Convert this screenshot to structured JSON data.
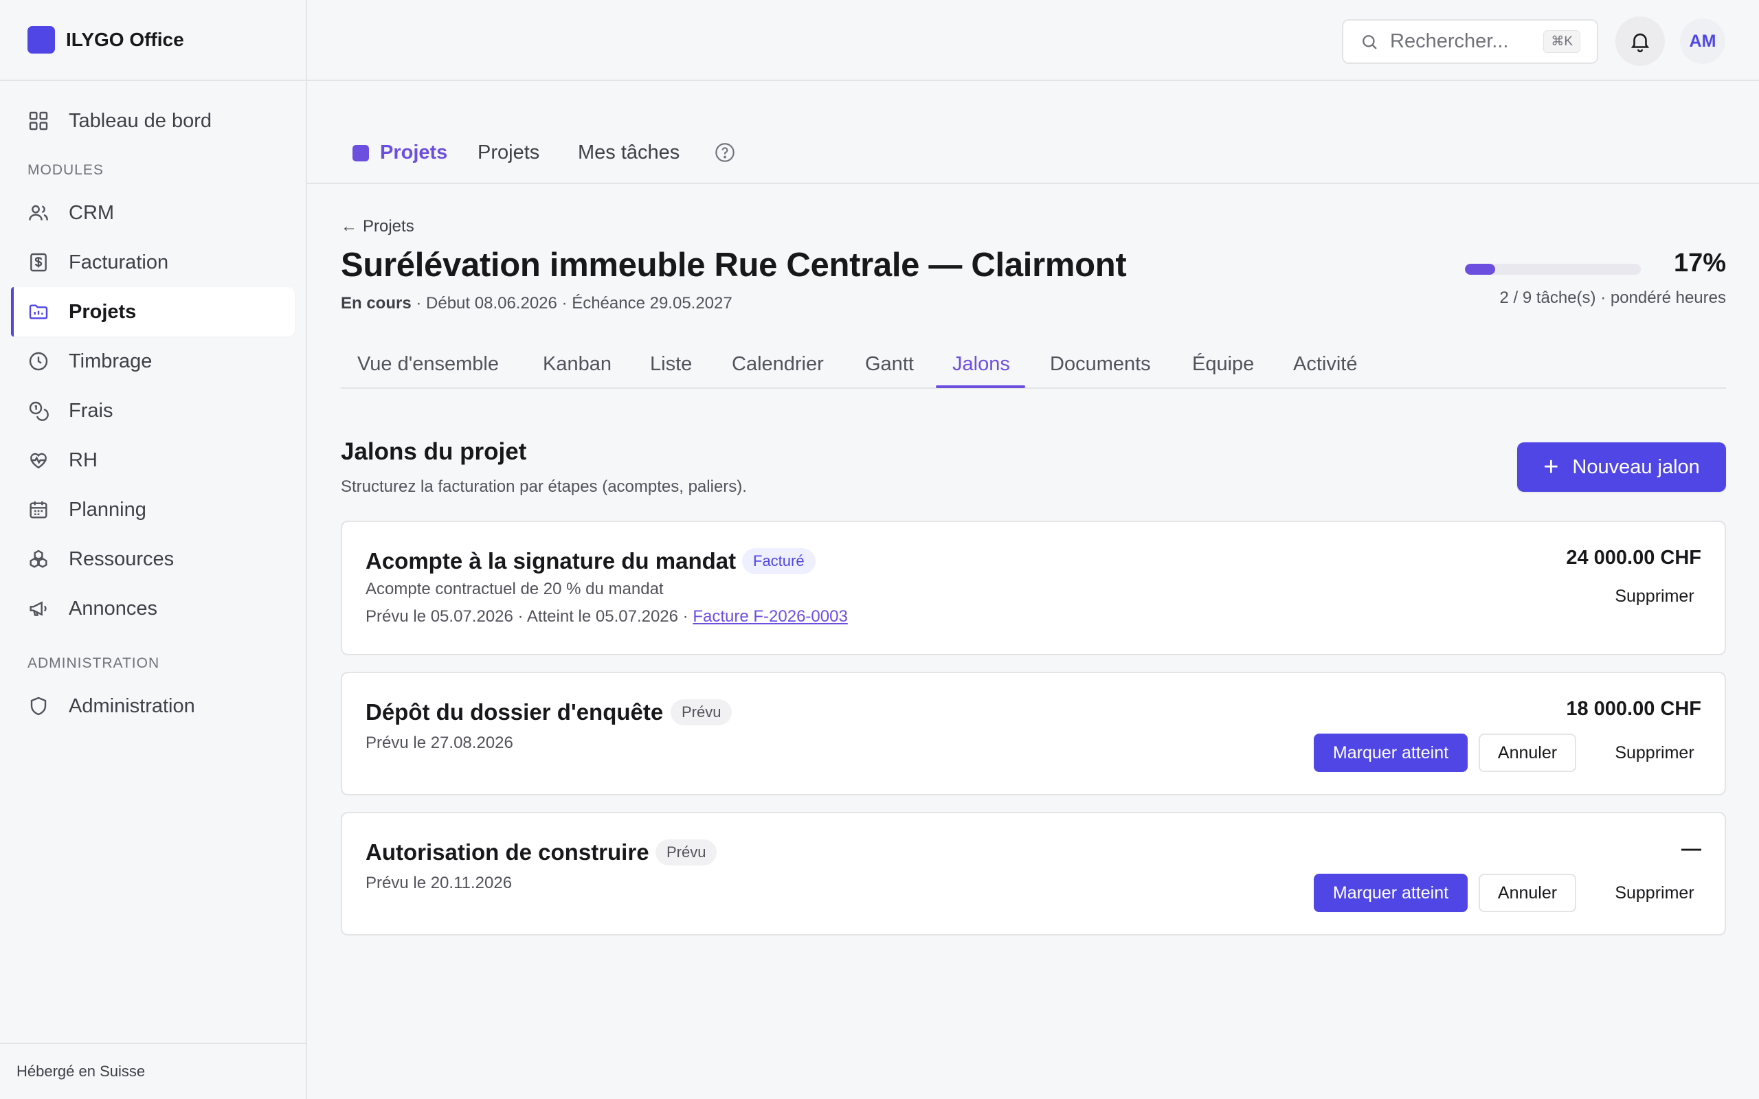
{
  "app": {
    "name": "ILYGO Office",
    "brand_color": "#4f46e5"
  },
  "sidebar": {
    "dashboard": {
      "label": "Tableau de bord",
      "icon": "grid-icon"
    },
    "modules_label": "MODULES",
    "items": [
      {
        "label": "CRM",
        "icon": "users-icon"
      },
      {
        "label": "Facturation",
        "icon": "invoice-icon"
      },
      {
        "label": "Projets",
        "icon": "folder-icon",
        "active": true
      },
      {
        "label": "Timbrage",
        "icon": "clock-icon"
      },
      {
        "label": "Frais",
        "icon": "coins-icon"
      },
      {
        "label": "RH",
        "icon": "heart-pulse-icon"
      },
      {
        "label": "Planning",
        "icon": "calendar-icon"
      },
      {
        "label": "Ressources",
        "icon": "boxes-icon"
      },
      {
        "label": "Annonces",
        "icon": "megaphone-icon"
      }
    ],
    "admin_label": "ADMINISTRATION",
    "admin_item": {
      "label": "Administration",
      "icon": "shield-icon"
    },
    "footer": "Hébergé en Suisse"
  },
  "topbar": {
    "search_placeholder": "Rechercher...",
    "search_shortcut": "⌘K",
    "avatar_initials": "AM"
  },
  "module_nav": {
    "brand": "Projets",
    "tabs": [
      "Projets",
      "Mes tâches"
    ]
  },
  "project": {
    "back_label": "Projets",
    "title": "Surélévation immeuble Rue Centrale — Clairmont",
    "status": "En cours",
    "meta": " · Début 08.06.2026 · Échéance 29.05.2027",
    "progress_percent": 17,
    "progress_label": "17%",
    "progress_sub": "2 / 9 tâche(s) · pondéré heures"
  },
  "tabs": {
    "items": [
      "Vue d'ensemble",
      "Kanban",
      "Liste",
      "Calendrier",
      "Gantt",
      "Jalons",
      "Documents",
      "Équipe",
      "Activité"
    ],
    "active": "Jalons"
  },
  "milestones": {
    "title": "Jalons du projet",
    "subtitle": "Structurez la facturation par étapes (acomptes, paliers).",
    "new_button": "Nouveau jalon",
    "items": [
      {
        "name": "Acompte à la signature du mandat",
        "badge": "Facturé",
        "description": "Acompte contractuel de 20 % du mandat",
        "dates": "Prévu le 05.07.2026 · Atteint le 05.07.2026 · ",
        "invoice_link": "Facture F-2026-0003",
        "amount": "24 000.00 CHF",
        "delete_label": "Supprimer"
      },
      {
        "name": "Dépôt du dossier d'enquête",
        "badge": "Prévu",
        "dates": "Prévu le 27.08.2026",
        "amount": "18 000.00 CHF",
        "mark_label": "Marquer atteint",
        "cancel_label": "Annuler",
        "delete_label": "Supprimer"
      },
      {
        "name": "Autorisation de construire",
        "badge": "Prévu",
        "dates": "Prévu le 20.11.2026",
        "amount": "—",
        "mark_label": "Marquer atteint",
        "cancel_label": "Annuler",
        "delete_label": "Supprimer"
      }
    ]
  }
}
